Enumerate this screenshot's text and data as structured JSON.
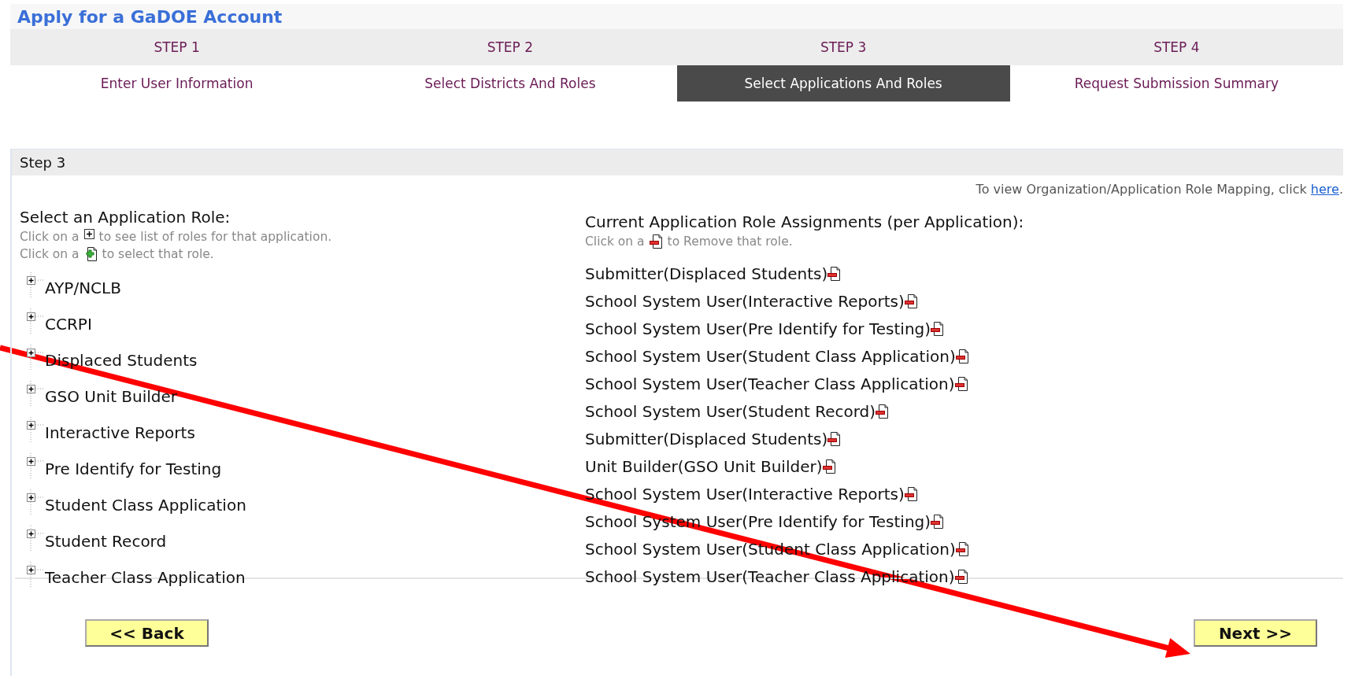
{
  "page_title": "Apply for a GaDOE Account",
  "steps": [
    {
      "number": "STEP 1",
      "label": "Enter User Information",
      "selected": false
    },
    {
      "number": "STEP 2",
      "label": "Select Districts And Roles",
      "selected": false
    },
    {
      "number": "STEP 3",
      "label": "Select Applications And Roles",
      "selected": true
    },
    {
      "number": "STEP 4",
      "label": "Request Submission Summary",
      "selected": false
    }
  ],
  "section": {
    "title": "Step 3",
    "mapping_note": {
      "text": "To view Organization/Application Role Mapping, click ",
      "link": "here",
      "end": "."
    }
  },
  "left": {
    "heading": "Select an Application Role:",
    "hints": [
      {
        "before": "Click on a",
        "kind": "expand",
        "after": "to see list of roles for that application."
      },
      {
        "before": "Click on a",
        "kind": "add",
        "after": "to select that role."
      }
    ],
    "applications": [
      {
        "label": "AYP/NCLB",
        "expanded": false
      },
      {
        "label": "CCRPI",
        "expanded": false
      },
      {
        "label": "Displaced Students",
        "expanded": false
      },
      {
        "label": "GSO Unit Builder",
        "expanded": false
      },
      {
        "label": "Interactive Reports",
        "expanded": false
      },
      {
        "label": "Pre Identify for Testing",
        "expanded": false
      },
      {
        "label": "Student Class Application",
        "expanded": false
      },
      {
        "label": "Student Record",
        "expanded": false
      },
      {
        "label": "Teacher Class Application",
        "expanded": false
      }
    ]
  },
  "right": {
    "heading": "Current Application Role Assignments (per Application):",
    "hint": {
      "before": "Click on a",
      "kind": "remove",
      "after": "to Remove that role."
    },
    "assignments": [
      "Submitter(Displaced Students)",
      "School System User(Interactive Reports)",
      "School System User(Pre Identify for Testing)",
      "School System User(Student Class Application)",
      "School System User(Teacher Class Application)",
      "School System User(Student Record)",
      "Submitter(Displaced Students)",
      "Unit Builder(GSO Unit Builder)",
      "School System User(Interactive Reports)",
      "School System User(Pre Identify for Testing)",
      "School System User(Student Class Application)",
      "School System User(Teacher Class Application)"
    ]
  },
  "buttons": {
    "back": "<< Back",
    "next": "Next >>"
  }
}
